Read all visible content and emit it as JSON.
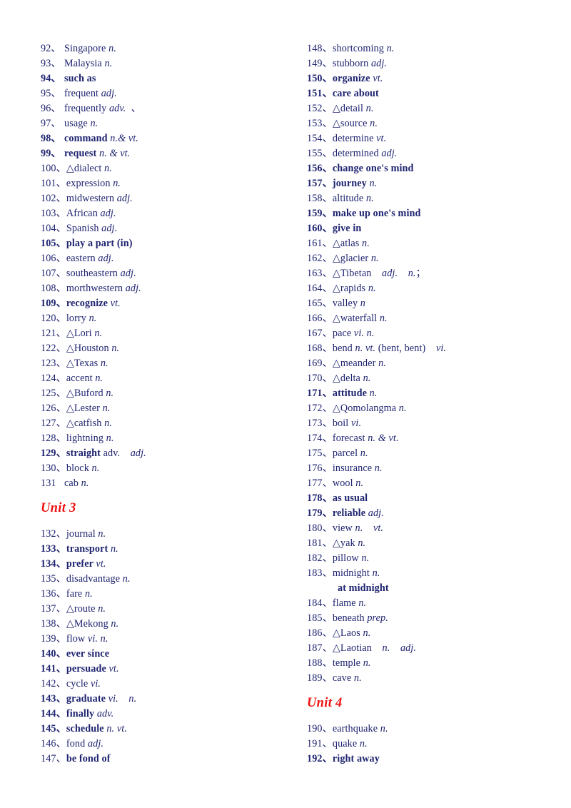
{
  "document": {
    "title": "English Vocabulary List (Units 3-4)",
    "text_color": "#1f2470",
    "heading_color": "#ee1111",
    "background": "#ffffff"
  },
  "columns": [
    {
      "name": "left-column",
      "blocks": [
        {
          "type": "entries",
          "items": [
            {
              "num": "92、",
              "word": "Singapore ",
              "pos": "n.",
              "bold": false
            },
            {
              "num": "93、",
              "word": "Malaysia ",
              "pos": "n.",
              "bold": false
            },
            {
              "num": "94、",
              "word": "such as",
              "pos": "",
              "bold": true
            },
            {
              "num": "95、",
              "word": "frequent ",
              "pos": "adj.",
              "bold": false
            },
            {
              "num": "96、",
              "word": "frequently ",
              "pos": "adv.",
              "tail": "  、",
              "bold": false
            },
            {
              "num": "97、",
              "word": "usage ",
              "pos": "n.",
              "bold": false
            },
            {
              "num": "98、",
              "word": "command ",
              "pos": "n.& vt.",
              "bold": true
            },
            {
              "num": "99、",
              "word": "request ",
              "pos": "n. & vt.",
              "bold": true
            },
            {
              "num": "100、",
              "word": "△dialect ",
              "pos": "n.",
              "bold": false
            },
            {
              "num": "101、",
              "word": "expression ",
              "pos": "n.",
              "bold": false
            },
            {
              "num": "102、",
              "word": "midwestern ",
              "pos": "adj.",
              "bold": false
            },
            {
              "num": "103、",
              "word": "African ",
              "pos": "adj.",
              "bold": false
            },
            {
              "num": "104、",
              "word": "Spanish ",
              "pos": "adj.",
              "bold": false
            },
            {
              "num": "105、",
              "word": "play a part (in)",
              "pos": "",
              "bold": true
            },
            {
              "num": "106、",
              "word": "eastern ",
              "pos": "adj.",
              "bold": false
            },
            {
              "num": "107、",
              "word": "southeastern ",
              "pos": "adj.",
              "bold": false
            },
            {
              "num": "108、",
              "word": "morthwestern ",
              "pos": "adj.",
              "bold": false
            },
            {
              "num": "109、",
              "word": "recognize ",
              "pos": "vt.",
              "bold": true
            },
            {
              "num": "120、",
              "word": "lorry ",
              "pos": "n.",
              "bold": false
            },
            {
              "num": "121、",
              "word": "△Lori ",
              "pos": "n.",
              "bold": false
            },
            {
              "num": "122、",
              "word": "△Houston ",
              "pos": "n.",
              "bold": false
            },
            {
              "num": "123、",
              "word": "△Texas ",
              "pos": "n.",
              "bold": false
            },
            {
              "num": "124、",
              "word": "accent ",
              "pos": "n.",
              "bold": false
            },
            {
              "num": "125、",
              "word": "△Buford ",
              "pos": "n.",
              "bold": false
            },
            {
              "num": "126、",
              "word": "△Lester ",
              "pos": "n.",
              "bold": false
            },
            {
              "num": "127、",
              "word": "△catfish ",
              "pos": "n.",
              "bold": false
            },
            {
              "num": "128、",
              "word": "lightning ",
              "pos": "n.",
              "bold": false
            },
            {
              "num": "129、",
              "word": "straight ",
              "pos_roman": "adv.",
              "pos_gap": "    ",
              "pos": "adj.",
              "bold": true
            },
            {
              "num": "130、",
              "word": "block ",
              "pos": "n.",
              "bold": false
            },
            {
              "num": "131",
              "word": "cab ",
              "pos": "n.",
              "bold": false
            }
          ]
        },
        {
          "type": "unit-heading",
          "label": "Unit 3"
        },
        {
          "type": "entries",
          "items": [
            {
              "num": "132、",
              "word": "journal ",
              "pos": "n.",
              "bold": false
            },
            {
              "num": "133、",
              "word": "transport ",
              "pos": "n.",
              "bold": true
            },
            {
              "num": "134、",
              "word": "prefer ",
              "pos": "vt.",
              "bold": true
            },
            {
              "num": "135、",
              "word": "disadvantage ",
              "pos": "n.",
              "bold": false
            },
            {
              "num": "136、",
              "word": "fare ",
              "pos": "n.",
              "bold": false
            },
            {
              "num": "137、",
              "word": "△route ",
              "pos": "n.",
              "bold": false
            },
            {
              "num": "138、",
              "word": "△Mekong ",
              "pos": "n.",
              "bold": false
            },
            {
              "num": "139、",
              "word": "flow ",
              "pos": "vi. n.",
              "bold": false
            },
            {
              "num": "140、",
              "word": "ever since",
              "pos": "",
              "bold": true
            },
            {
              "num": "141、",
              "word": "persuade ",
              "pos": "vt.",
              "bold": true
            },
            {
              "num": "142、",
              "word": "cycle ",
              "pos": "vi.",
              "bold": false
            },
            {
              "num": "143、",
              "word": "graduate ",
              "pos": "vi.    n.",
              "bold": true
            },
            {
              "num": "144、",
              "word": "finally ",
              "pos": "adv.",
              "bold": true
            },
            {
              "num": "145、",
              "word": "schedule ",
              "pos": "n. vt.",
              "bold": true
            },
            {
              "num": "146、",
              "word": "fond ",
              "pos": "adj.",
              "bold": false
            },
            {
              "num": "147、",
              "word": "be fond of",
              "pos": "",
              "bold": false,
              "bold_word": true
            }
          ]
        }
      ]
    },
    {
      "name": "right-column",
      "blocks": [
        {
          "type": "entries",
          "items": [
            {
              "num": "148、",
              "word": "shortcoming ",
              "pos": "n.",
              "bold": false
            },
            {
              "num": "149、",
              "word": "stubborn ",
              "pos": "adj.",
              "bold": false
            },
            {
              "num": "150、",
              "word": "organize ",
              "pos": "vt.",
              "bold": true
            },
            {
              "num": "151、",
              "word": "care about",
              "pos": "",
              "bold": true
            },
            {
              "num": "152、",
              "word": "△detail ",
              "pos": "n.",
              "bold": false
            },
            {
              "num": "153、",
              "word": "△source ",
              "pos": "n.",
              "bold": false
            },
            {
              "num": "154、",
              "word": "determine ",
              "pos": "vt.",
              "bold": false
            },
            {
              "num": "155、",
              "word": "determined ",
              "pos": "adj.",
              "bold": false
            },
            {
              "num": "156、",
              "word": "change one's mind",
              "pos": "",
              "bold": true
            },
            {
              "num": "157、",
              "word": "journey ",
              "pos": "n.",
              "bold": true
            },
            {
              "num": "158、",
              "word": "altitude ",
              "pos": "n.",
              "bold": false
            },
            {
              "num": "159、",
              "word": "make up one's mind",
              "pos": "",
              "bold": true
            },
            {
              "num": "160、",
              "word": "give in",
              "pos": "",
              "bold": true
            },
            {
              "num": "161、",
              "word": "△atlas ",
              "pos": "n.",
              "bold": false
            },
            {
              "num": "162、",
              "word": "△glacier ",
              "pos": "n.",
              "bold": false
            },
            {
              "num": "163、",
              "word": "△Tibetan    ",
              "pos": "adj.",
              "pos_gap2": "    ",
              "pos2": "n.",
              "tail": "；",
              "bold": false
            },
            {
              "num": "164、",
              "word": "△rapids ",
              "pos": "n.",
              "bold": false
            },
            {
              "num": "165、",
              "word": "valley ",
              "pos": "n",
              "bold": false
            },
            {
              "num": "166、",
              "word": "△waterfall ",
              "pos": "n.",
              "bold": false
            },
            {
              "num": "167、",
              "word": "pace ",
              "pos": "vi. n.",
              "bold": false
            },
            {
              "num": "168、",
              "word": "bend ",
              "pos": "n. vt.",
              "pos_roman2": " (bent, bent)    ",
              "pos2": "vi.",
              "bold": false
            },
            {
              "num": "169、",
              "word": "△meander ",
              "pos": "n.",
              "bold": false
            },
            {
              "num": "170、",
              "word": "△delta ",
              "pos": "n.",
              "bold": false
            },
            {
              "num": "171、",
              "word": "attitude ",
              "pos": "n.",
              "bold": true
            },
            {
              "num": "172、",
              "word": "△Qomolangma ",
              "pos": "n.",
              "bold": false
            },
            {
              "num": "173、",
              "word": "boil ",
              "pos": "vi.",
              "bold": false
            },
            {
              "num": "174、",
              "word": "forecast ",
              "pos": "n. & vt.",
              "bold": false
            },
            {
              "num": "175、",
              "word": "parcel ",
              "pos": "n.",
              "bold": false
            },
            {
              "num": "176、",
              "word": "insurance ",
              "pos": "n.",
              "bold": false
            },
            {
              "num": "177、",
              "word": "wool ",
              "pos": "n.",
              "bold": false
            },
            {
              "num": "178、",
              "word": "as usual",
              "pos": "",
              "bold": true
            },
            {
              "num": "179、",
              "word": "reliable ",
              "pos": "adj.",
              "bold": true
            },
            {
              "num": "180、",
              "word": "view ",
              "pos": "n.    vt.",
              "bold": false
            },
            {
              "num": "181、",
              "word": "△yak ",
              "pos": "n.",
              "bold": false
            },
            {
              "num": "182、",
              "word": "pillow ",
              "pos": "n.",
              "bold": false
            },
            {
              "num": "183、",
              "word": "midnight ",
              "pos": "n.",
              "bold": false
            },
            {
              "phrase": "at midnight"
            },
            {
              "num": "184、",
              "word": "flame ",
              "pos": "n.",
              "bold": false
            },
            {
              "num": "185、",
              "word": "beneath ",
              "pos": "prep.",
              "bold": false
            },
            {
              "num": "186、",
              "word": "△Laos ",
              "pos": "n.",
              "bold": false
            },
            {
              "num": "187、",
              "word": "△Laotian    ",
              "pos": "n.",
              "pos_gap2": "    ",
              "pos2": "adj.",
              "bold": false
            },
            {
              "num": "188、",
              "word": "temple ",
              "pos": "n.",
              "bold": false
            },
            {
              "num": "189、",
              "word": "cave ",
              "pos": "n.",
              "bold": false
            }
          ]
        },
        {
          "type": "unit-heading",
          "label": "Unit 4"
        },
        {
          "type": "entries",
          "items": [
            {
              "num": "190、",
              "word": "earthquake ",
              "pos": "n.",
              "bold": false
            },
            {
              "num": "191、",
              "word": "quake ",
              "pos": "n.",
              "bold": false
            },
            {
              "num": "192、",
              "word": "right away",
              "pos": "",
              "bold": true
            }
          ]
        }
      ]
    }
  ]
}
